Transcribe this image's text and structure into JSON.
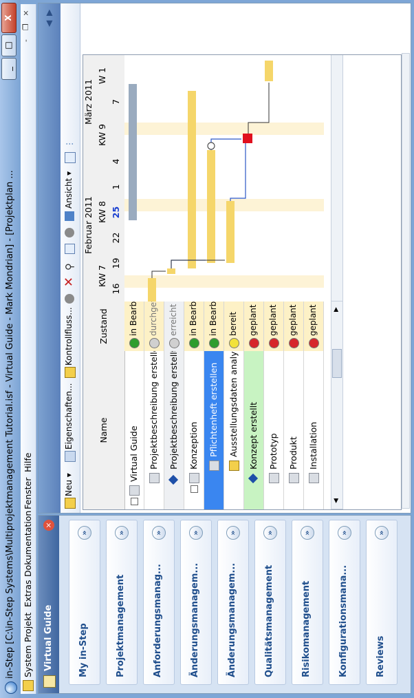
{
  "window": {
    "title": "in-Step [C:\\in-Step Systems\\Multiprojektmanagement Tutorial.isf - Virtual Guide - Mark Mondrian] - [Projektplan ...",
    "controls": {
      "minimize": "_",
      "maximize": "□",
      "close": "X"
    }
  },
  "menu": {
    "items": [
      "System",
      "Projekt",
      "Extras",
      "Dokumentation",
      "Fenster",
      "Hilfe"
    ],
    "mdi": {
      "minimize": "-",
      "restore": "❐",
      "close": "×"
    }
  },
  "nav": {
    "title": "Virtual Guide",
    "close": "×",
    "groups": [
      {
        "label": "My in-Step",
        "expand": "»"
      },
      {
        "label": "Projektmanagement",
        "expand": "»"
      },
      {
        "label": "Anforderungsmanag...",
        "expand": "»"
      },
      {
        "label": "Änderungsmanagem...",
        "expand": "»"
      },
      {
        "label": "Änderungsmanagem...",
        "expand": "»"
      },
      {
        "label": "Qualitätsmanagement",
        "expand": "»"
      },
      {
        "label": "Risikomanagement",
        "expand": "»"
      },
      {
        "label": "Konfigurationsmana...",
        "expand": "»"
      },
      {
        "label": "Reviews",
        "expand": "»"
      }
    ]
  },
  "toolbar": {
    "neu": "Neu ▾",
    "eigenschaften": "Eigenschaften...",
    "kontrollfluss": "Kontrollfluss...",
    "ansicht": "Ansicht ▾"
  },
  "grid": {
    "headers": {
      "name": "Name",
      "zustand": "Zustand"
    },
    "months": [
      "Februar 2011",
      "März 2011"
    ],
    "weeks": [
      "KW 7",
      "KW 8",
      "KW 9",
      "W 1"
    ],
    "days": [
      "16",
      "19",
      "22",
      "25",
      "1",
      "4",
      "7"
    ],
    "highlight_day": "25",
    "rows": [
      {
        "name": "Virtual Guide",
        "state": "in Bearbeitung",
        "dot": "#2e9d2e",
        "icon": "task"
      },
      {
        "name": "Projektbeschreibung erstellen",
        "state": "durchgeführt",
        "dot": "#cfcfcf",
        "icon": "task"
      },
      {
        "name": "Projektbeschreibung erstellt",
        "state": "erreicht",
        "dot": "#cfcfcf",
        "icon": "milestone"
      },
      {
        "name": "Konzeption",
        "state": "in Bearbeitung",
        "dot": "#2e9d2e",
        "icon": "task"
      },
      {
        "name": "Pflichtenheft erstellen",
        "state": "in Bearbeitung",
        "dot": "#2e9d2e",
        "icon": "task",
        "selected": true
      },
      {
        "name": "Ausstellungsdaten analysieren",
        "state": "bereit",
        "dot": "#f2e23a",
        "icon": "task"
      },
      {
        "name": "Konzept erstellt",
        "state": "geplant",
        "dot": "#d6262b",
        "icon": "milestone",
        "green": true
      },
      {
        "name": "Prototyp",
        "state": "geplant",
        "dot": "#d6262b",
        "icon": "task"
      },
      {
        "name": "Produkt",
        "state": "geplant",
        "dot": "#d6262b",
        "icon": "task"
      },
      {
        "name": "Installation",
        "state": "geplant",
        "dot": "#d6262b",
        "icon": "task"
      }
    ]
  },
  "colors": {
    "selected_row": "#3a86f0",
    "milestone_row": "#c8f3c2",
    "state_bg": "#fdf1c6",
    "bar": "#f5d66a",
    "summary_bar": "#9aabbf"
  }
}
